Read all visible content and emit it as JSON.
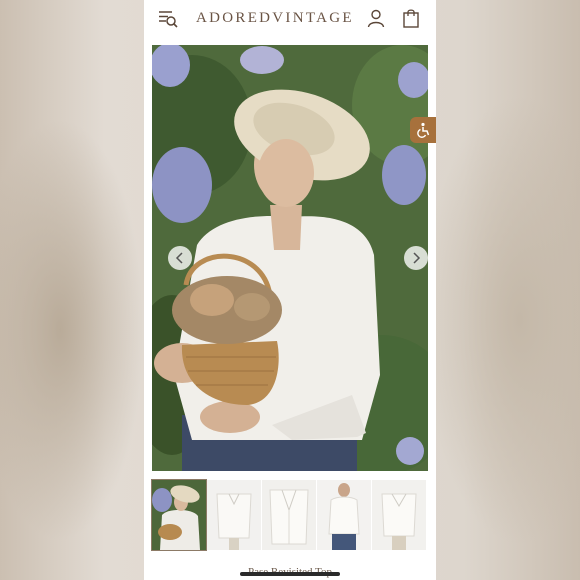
{
  "header": {
    "logo_text": "ADOREDVINTAGE",
    "menu_icon": "menu-search-icon",
    "account_icon": "user-icon",
    "cart_icon": "shopping-bag-icon"
  },
  "gallery": {
    "prev_icon": "chevron-left-icon",
    "next_icon": "chevron-right-icon",
    "thumbnail_count": 5,
    "active_thumbnail": 1
  },
  "accessibility": {
    "icon": "wheelchair-icon",
    "color": "#a7713c"
  },
  "product": {
    "title": "Pase Revisited Top"
  },
  "colors": {
    "brand": "#6a5445",
    "accent": "#a7713c"
  }
}
